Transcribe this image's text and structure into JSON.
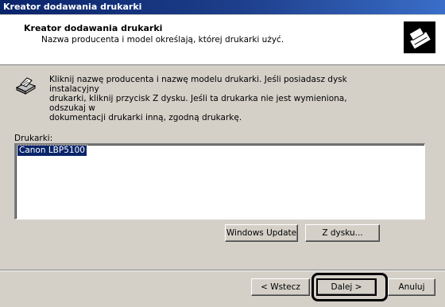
{
  "window": {
    "title": "Kreator dodawania drukarki"
  },
  "header": {
    "title": "Kreator dodawania drukarki",
    "subtitle": "Nazwa producenta i model określają, której drukarki użyć.",
    "icon": "printer-wizard-icon"
  },
  "instructions": {
    "icon": "printer-icon",
    "line1": "Kliknij nazwę producenta i nazwę modelu drukarki. Jeśli posiadasz dysk instalacyjny",
    "line2": "drukarki, kliknij przycisk Z dysku. Jeśli ta drukarka nie jest wymieniona, odszukaj w",
    "line3": "dokumentacji drukarki inną, zgodną drukarkę."
  },
  "printers": {
    "label": "Drukarki:",
    "items": [
      "Canon LBP5100"
    ],
    "selected": "Canon LBP5100"
  },
  "actions": {
    "windows_update": "Windows Update",
    "have_disk": "Z dysku..."
  },
  "footer": {
    "back": "< Wstecz",
    "next": "Dalej >",
    "cancel": "Anuluj"
  },
  "colors": {
    "titlebar": "#0a246a",
    "face": "#d4d0c8",
    "selection": "#0a246a"
  }
}
